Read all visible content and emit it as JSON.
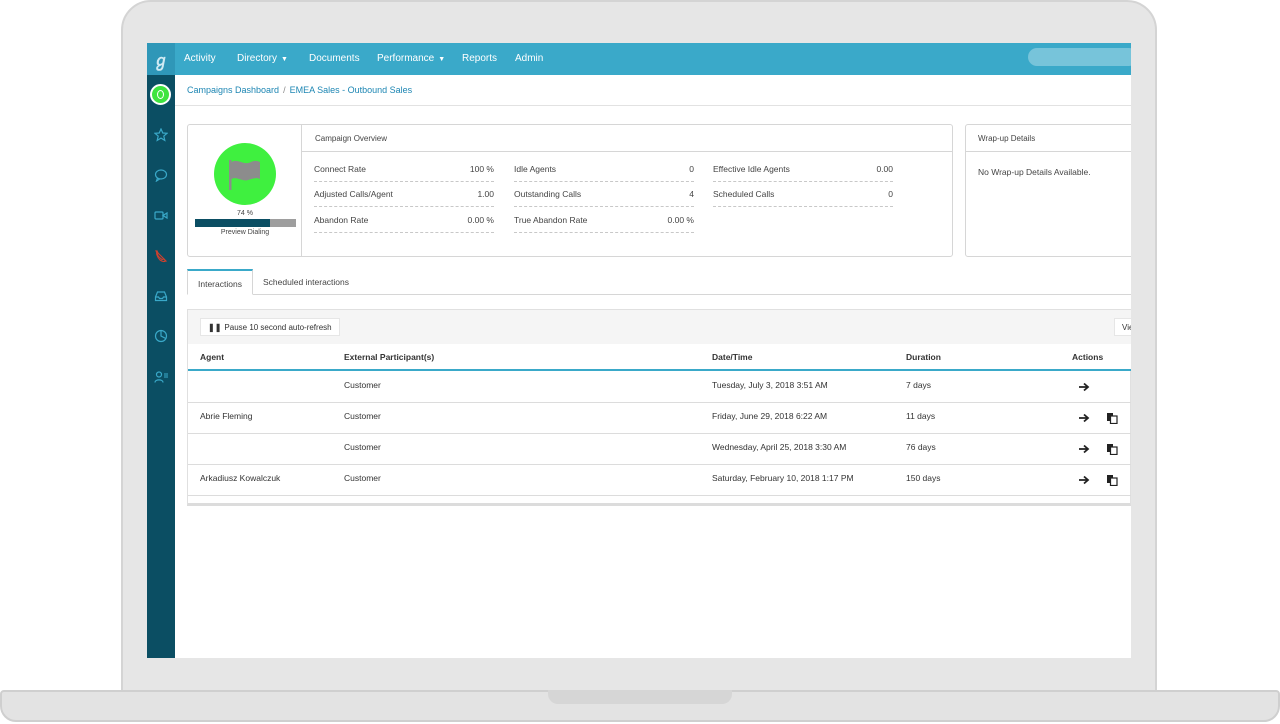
{
  "nav": {
    "items": [
      {
        "label": "Activity",
        "dropdown": false
      },
      {
        "label": "Directory",
        "dropdown": true
      },
      {
        "label": "Documents",
        "dropdown": false
      },
      {
        "label": "Performance",
        "dropdown": true
      },
      {
        "label": "Reports",
        "dropdown": false
      },
      {
        "label": "Admin",
        "dropdown": false
      }
    ],
    "accent_color": "#3aa9c9"
  },
  "sidebar": {
    "icons": [
      "user-avatar-icon",
      "star-icon",
      "chat-bubble-icon",
      "video-icon",
      "phone-off-icon",
      "inbox-icon",
      "chart-icon",
      "contacts-icon"
    ],
    "color": "#0b4e63"
  },
  "breadcrumb": {
    "items": [
      "Campaigns Dashboard",
      "EMEA Sales - Outbound Sales"
    ],
    "separator": "/"
  },
  "campaign": {
    "status_color": "#3ff03f",
    "progress_percent_label": "74 %",
    "progress_value": 0.74,
    "mode_label": "Preview Dialing",
    "overview_title": "Campaign Overview",
    "metrics": [
      {
        "label": "Connect Rate",
        "value": "100 %"
      },
      {
        "label": "Adjusted Calls/Agent",
        "value": "1.00"
      },
      {
        "label": "Abandon Rate",
        "value": "0.00 %"
      },
      {
        "label": "Idle Agents",
        "value": "0"
      },
      {
        "label": "Outstanding Calls",
        "value": "4"
      },
      {
        "label": "True Abandon Rate",
        "value": "0.00 %"
      },
      {
        "label": "Effective Idle Agents",
        "value": "0.00"
      },
      {
        "label": "Scheduled Calls",
        "value": "0"
      }
    ]
  },
  "wrapup": {
    "title": "Wrap-up Details",
    "message": "No Wrap-up Details Available."
  },
  "tabs": [
    {
      "label": "Interactions",
      "active": true
    },
    {
      "label": "Scheduled interactions",
      "active": false
    }
  ],
  "table": {
    "pause_button": "Pause 10 second auto-refresh",
    "view_button": "View",
    "columns": [
      "Agent",
      "External Participant(s)",
      "Date/Time",
      "Duration",
      "Actions"
    ],
    "rows": [
      {
        "agent": "",
        "participant": "Customer",
        "datetime": "Tuesday, July 3, 2018 3:51 AM",
        "duration": "7 days",
        "actions": [
          "arrow-right-icon"
        ]
      },
      {
        "agent": "Abrie Fleming",
        "participant": "Customer",
        "datetime": "Friday, June 29, 2018 6:22 AM",
        "duration": "11 days",
        "actions": [
          "arrow-right-icon",
          "copy-icon"
        ]
      },
      {
        "agent": "",
        "participant": "Customer",
        "datetime": "Wednesday, April 25, 2018 3:30 AM",
        "duration": "76 days",
        "actions": [
          "arrow-right-icon",
          "copy-icon"
        ]
      },
      {
        "agent": "Arkadiusz Kowalczuk",
        "participant": "Customer",
        "datetime": "Saturday, February 10, 2018 1:17 PM",
        "duration": "150 days",
        "actions": [
          "arrow-right-icon",
          "copy-icon"
        ]
      }
    ]
  }
}
